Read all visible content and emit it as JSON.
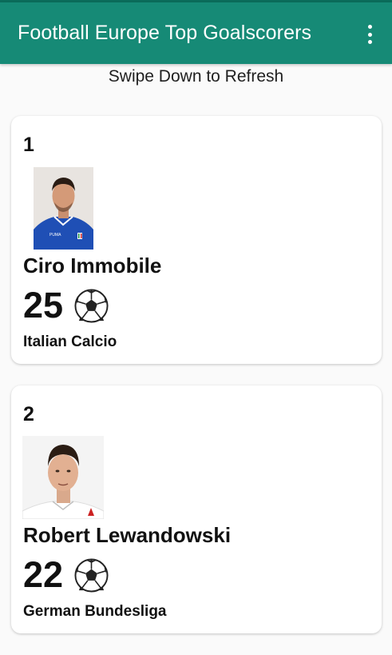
{
  "app": {
    "title": "Football Europe Top Goalscorers",
    "overflow_icon": "more-vert-icon",
    "accent": "#168a76"
  },
  "hint": "Swipe Down to Refresh",
  "scorers": [
    {
      "rank": "1",
      "name": "Ciro Immobile",
      "goals": "25",
      "league": "Italian Calcio",
      "icon": "soccer-ball-icon"
    },
    {
      "rank": "2",
      "name": "Robert Lewandowski",
      "goals": "22",
      "league": "German Bundesliga",
      "icon": "soccer-ball-icon"
    }
  ]
}
